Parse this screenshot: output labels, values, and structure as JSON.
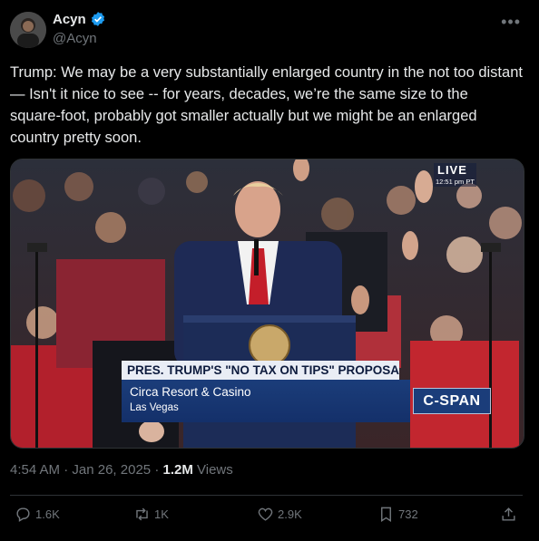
{
  "author": {
    "display_name": "Acyn",
    "handle": "@Acyn"
  },
  "tweet": {
    "text": "Trump: We may be a very substantially enlarged country in the not too distant— Isn't it nice to see -- for years, decades, we’re the same size to the square-foot, probably got smaller actually but we might be an enlarged country pretty soon."
  },
  "media": {
    "live_label": "LIVE",
    "live_time": "12:51 pm PT",
    "chyron_title": "PRES. TRUMP'S \"NO TAX ON TIPS\" PROPOSAL",
    "chyron_venue": "Circa Resort & Casino",
    "chyron_city": "Las Vegas",
    "network": "C-SPAN"
  },
  "meta": {
    "time": "4:54 AM",
    "date": "Jan 26, 2025",
    "views_count": "1.2M",
    "views_label": "Views"
  },
  "actions": {
    "replies": "1.6K",
    "reposts": "1K",
    "likes": "2.9K",
    "bookmarks": "732"
  },
  "colors": {
    "background": "#000000",
    "verified": "#1d9bf0",
    "muted": "#71767b"
  },
  "icons": [
    "verified-badge-icon",
    "more-icon",
    "reply-icon",
    "repost-icon",
    "like-icon",
    "bookmark-icon",
    "share-icon"
  ]
}
